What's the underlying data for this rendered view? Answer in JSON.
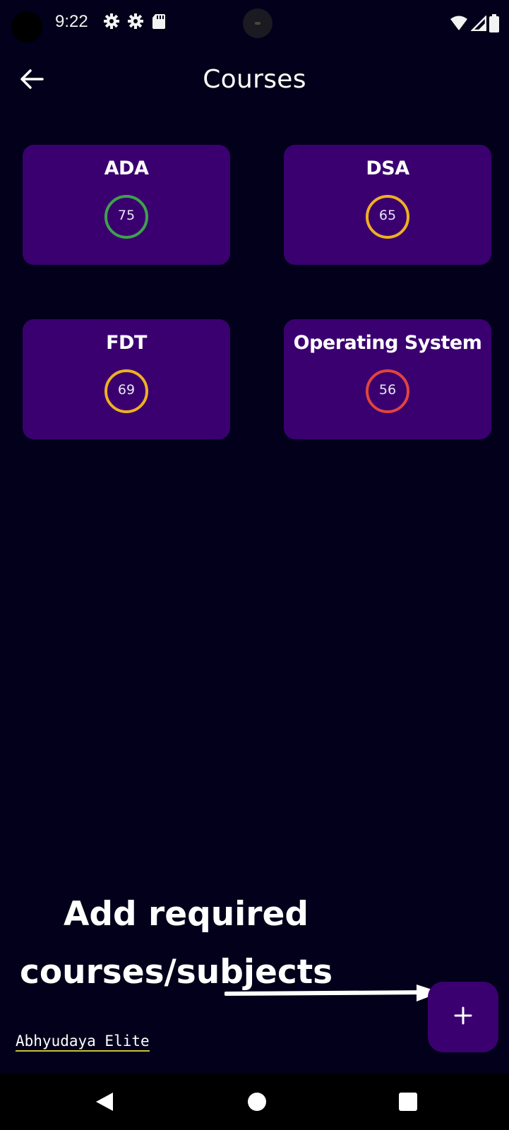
{
  "status_bar": {
    "time": "9:22",
    "icons": [
      "settings-gear-icon",
      "settings-gear-icon",
      "sd-card-icon"
    ],
    "right_icons": [
      "wifi-icon",
      "cellular-signal-icon",
      "battery-icon"
    ]
  },
  "app_bar": {
    "back_icon": "arrow-left-icon",
    "title": "Courses"
  },
  "courses": [
    {
      "name": "ADA",
      "score": "75",
      "ring_color": "#3fa14c"
    },
    {
      "name": "DSA",
      "score": "65",
      "ring_color": "#f0b020"
    },
    {
      "name": "FDT",
      "score": "69",
      "ring_color": "#f0b020"
    },
    {
      "name": "Operating System",
      "score": "56",
      "ring_color": "#e0443e"
    }
  ],
  "annotation": {
    "line1": "Add required",
    "line2": "courses/subjects",
    "arrow_icon": "arrow-right-icon"
  },
  "fab": {
    "icon": "plus-icon",
    "label": "+"
  },
  "credit": "Abhyudaya Elite",
  "nav_bar": {
    "icons": [
      "triangle-back-icon",
      "circle-home-icon",
      "square-recents-icon"
    ]
  },
  "colors": {
    "background": "#02001a",
    "card": "#3a0070",
    "credit_underline": "#c8c23a"
  }
}
